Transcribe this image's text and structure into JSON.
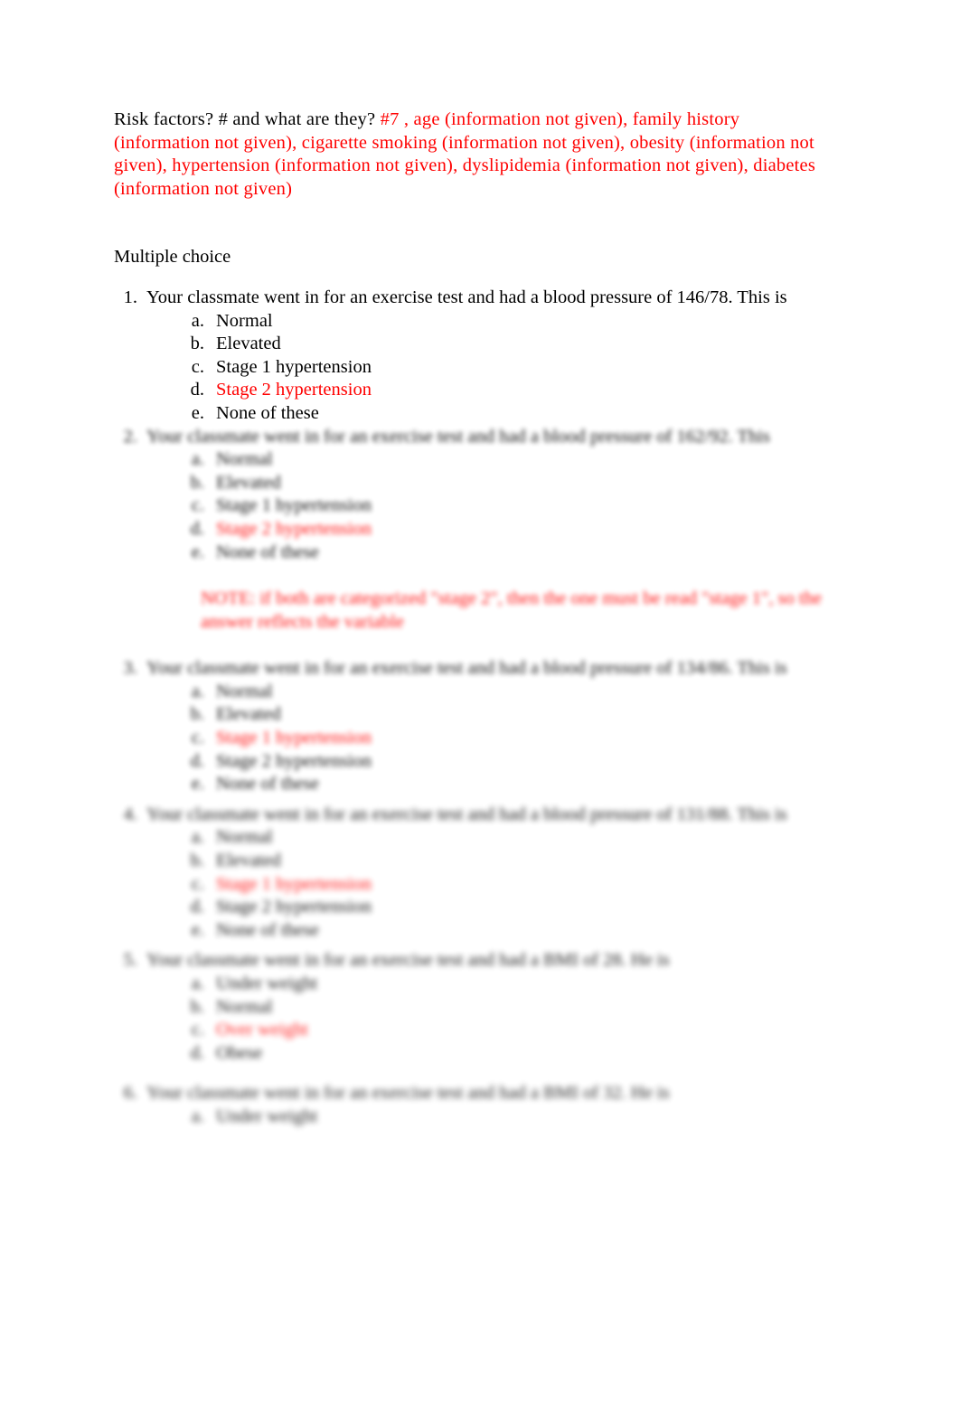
{
  "document": {
    "intro": {
      "prompt": "Risk factors? # and what are they?",
      "answer": "#7 , age (information not given), family history (information not given), cigarette smoking (information not given), obesity (information not given), hypertension (information not given), dyslipidemia (information not given), diabetes (information not given)"
    },
    "section_heading": "Multiple choice",
    "accent_color": "#ff0000",
    "questions": [
      {
        "number": "1.",
        "text": "Your classmate went in for an exercise test and had a blood pressure of 146/78. This is",
        "options": [
          {
            "letter": "a.",
            "text": "Normal",
            "highlighted": false
          },
          {
            "letter": "b.",
            "text": "Elevated",
            "highlighted": false
          },
          {
            "letter": "c.",
            "text": "Stage 1 hypertension",
            "highlighted": false
          },
          {
            "letter": "d.",
            "text": "Stage 2 hypertension",
            "highlighted": true
          },
          {
            "letter": "e.",
            "text": "None of these",
            "highlighted": false
          }
        ]
      },
      {
        "number": "2.",
        "text": "Your classmate went in for an exercise test and had a blood pressure of 162/92. This",
        "options": [
          {
            "letter": "a.",
            "text": "Normal",
            "highlighted": false
          },
          {
            "letter": "b.",
            "text": "Elevated",
            "highlighted": false
          },
          {
            "letter": "c.",
            "text": "Stage 1 hypertension",
            "highlighted": false
          },
          {
            "letter": "d.",
            "text": "Stage 2 hypertension",
            "highlighted": true
          },
          {
            "letter": "e.",
            "text": "None of these",
            "highlighted": false
          }
        ],
        "note": "NOTE: if both are categorized \"stage 2\", then the one must be read \"stage 1\", so the answer reflects the variable"
      },
      {
        "number": "3.",
        "text": "Your classmate went in for an exercise test and had a blood pressure of 134/86. This is",
        "options": [
          {
            "letter": "a.",
            "text": "Normal",
            "highlighted": false
          },
          {
            "letter": "b.",
            "text": "Elevated",
            "highlighted": false
          },
          {
            "letter": "c.",
            "text": "Stage 1 hypertension",
            "highlighted": true
          },
          {
            "letter": "d.",
            "text": "Stage 2 hypertension",
            "highlighted": false
          },
          {
            "letter": "e.",
            "text": "None of these",
            "highlighted": false
          }
        ]
      },
      {
        "number": "4.",
        "text": "Your classmate went in for an exercise test and had a blood pressure of 131/88. This is",
        "options": [
          {
            "letter": "a.",
            "text": "Normal",
            "highlighted": false
          },
          {
            "letter": "b.",
            "text": "Elevated",
            "highlighted": false
          },
          {
            "letter": "c.",
            "text": "Stage 1 hypertension",
            "highlighted": true
          },
          {
            "letter": "d.",
            "text": "Stage 2 hypertension",
            "highlighted": false
          },
          {
            "letter": "e.",
            "text": "None of these",
            "highlighted": false
          }
        ]
      },
      {
        "number": "5.",
        "text": "Your classmate went in for an exercise test and had a BMI of 28. He is",
        "options": [
          {
            "letter": "a.",
            "text": "Under weight",
            "highlighted": false
          },
          {
            "letter": "b.",
            "text": "Normal",
            "highlighted": false
          },
          {
            "letter": "c.",
            "text": "Over weight",
            "highlighted": true
          },
          {
            "letter": "d.",
            "text": "Obese",
            "highlighted": false
          }
        ]
      },
      {
        "number": "6.",
        "text": "Your classmate went in for an exercise test and had a BMI of 32. He is",
        "options": [
          {
            "letter": "a.",
            "text": "Under weight",
            "highlighted": false
          }
        ]
      }
    ]
  }
}
